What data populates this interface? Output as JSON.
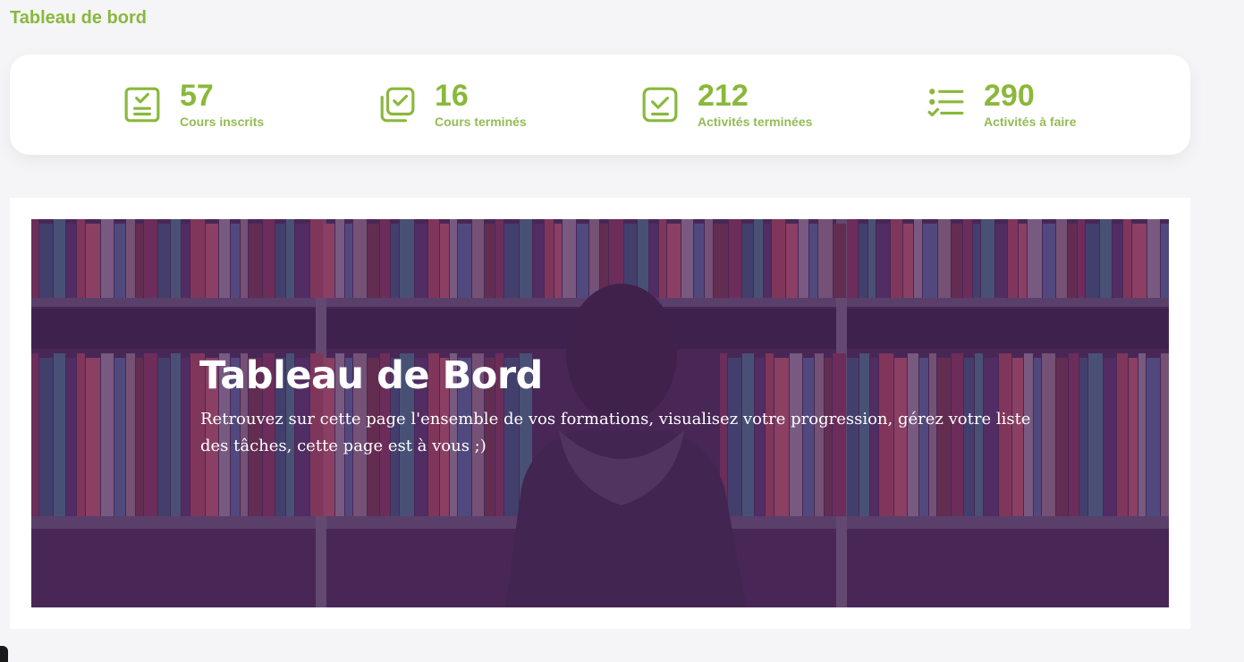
{
  "header": {
    "title": "Tableau de bord"
  },
  "stats": [
    {
      "value": "57",
      "label": "Cours inscrits",
      "icon": "checklist-icon"
    },
    {
      "value": "16",
      "label": "Cours terminés",
      "icon": "stacked-check-icon"
    },
    {
      "value": "212",
      "label": "Activités terminées",
      "icon": "check-box-icon"
    },
    {
      "value": "290",
      "label": "Activités à faire",
      "icon": "todo-list-icon"
    }
  ],
  "banner": {
    "title": "Tableau de Bord",
    "text": "Retrouvez sur cette page l'ensemble de vos formations, visualisez votre progression, gérez votre liste des tâches, cette page est à vous ;)"
  },
  "colors": {
    "accent": "#8ab83c",
    "overlay": "#4b2d55"
  }
}
